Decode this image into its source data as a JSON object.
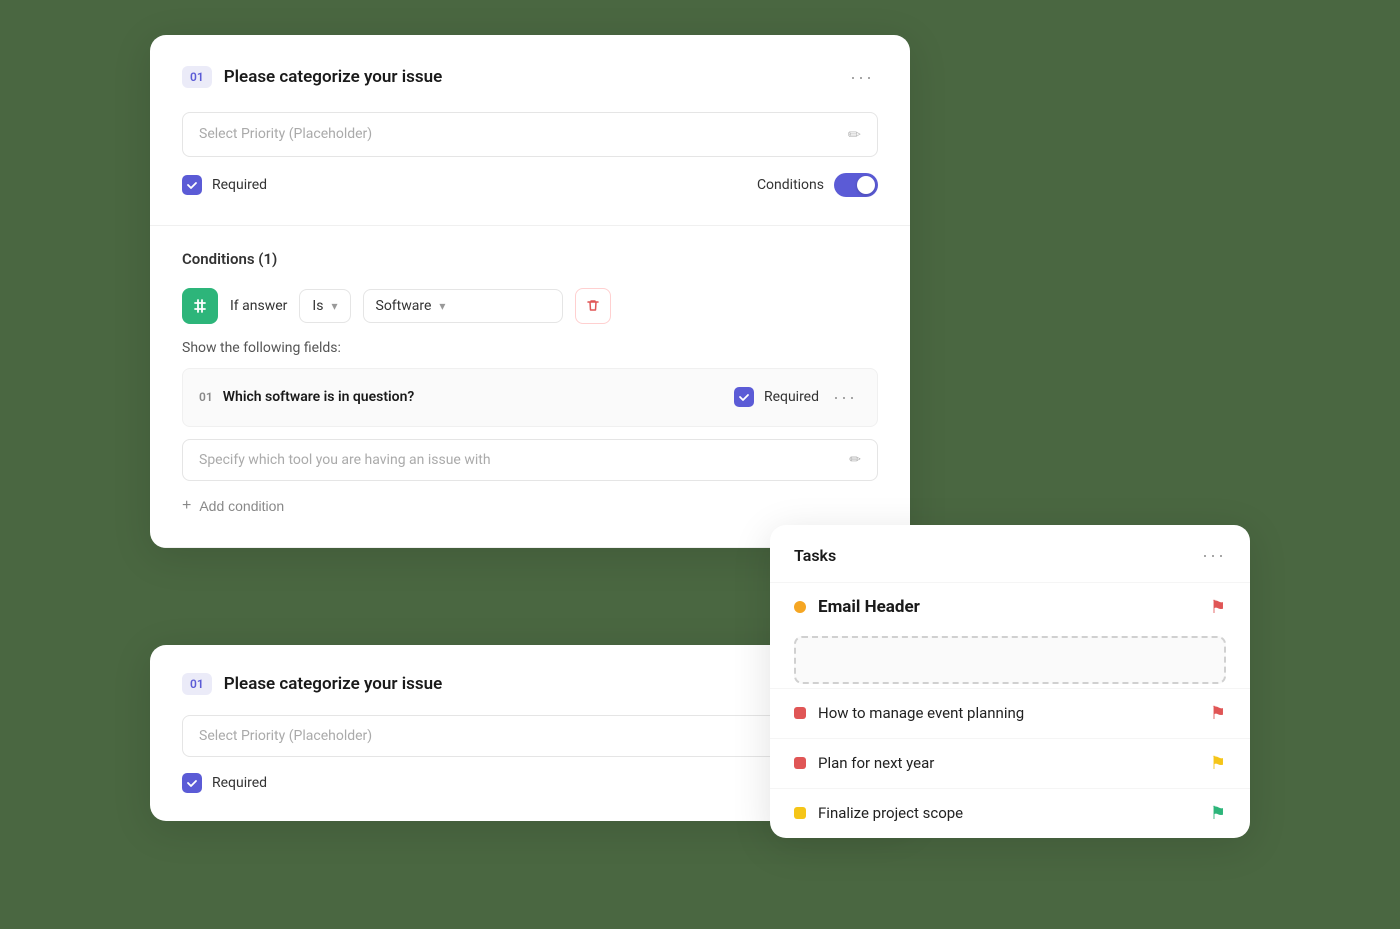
{
  "form_card_1": {
    "step_badge": "01",
    "title": "Please categorize your issue",
    "more_btn": "···",
    "placeholder_input": "Select Priority (Placeholder)",
    "required_label": "Required",
    "conditions_label": "Conditions"
  },
  "conditions_section": {
    "title": "Conditions (1)",
    "if_answer_label": "If answer",
    "is_select": "Is",
    "software_select": "Software",
    "show_fields_label": "Show the following fields:",
    "sub_field": {
      "step": "01",
      "title": "Which software is in question?",
      "required": "Required",
      "placeholder": "Specify which tool you are having an issue with"
    },
    "add_condition_label": "Add condition"
  },
  "form_card_2": {
    "step_badge": "01",
    "title": "Please categorize your issue",
    "placeholder_input": "Select Priority (Placeholder)",
    "required_label": "Required"
  },
  "tasks_card": {
    "title": "Tasks",
    "more_btn": "···",
    "email_header_title": "Email Header",
    "items": [
      {
        "text": "How to manage event planning",
        "dot_type": "red",
        "flag_color": "red"
      },
      {
        "text": "Plan for next year",
        "dot_type": "red",
        "flag_color": "yellow"
      },
      {
        "text": "Finalize project scope",
        "dot_type": "yellow",
        "flag_color": "green"
      }
    ]
  },
  "icons": {
    "edit_pencil": "✏",
    "checkmark": "✓",
    "chevron_down": "▾",
    "plus": "+",
    "trash": "🗑",
    "filter": "⇄"
  }
}
